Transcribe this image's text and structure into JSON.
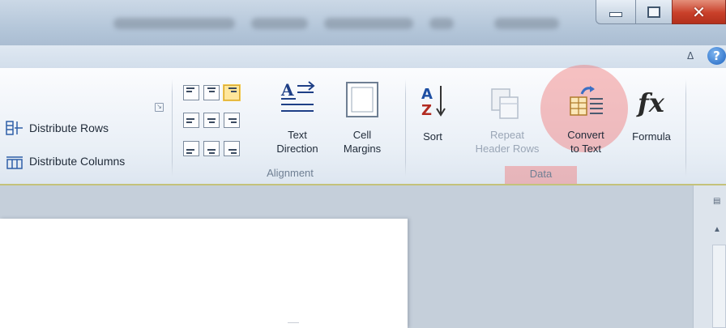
{
  "window": {
    "minimize_glyph": "",
    "maximize_glyph": "",
    "close_glyph": "✕",
    "help_glyph": "?",
    "collapse_glyph": "ᐃ"
  },
  "ribbon": {
    "cell_size": {
      "distribute_rows": "Distribute Rows",
      "distribute_columns": "Distribute Columns"
    },
    "alignment": {
      "group_label": "Alignment",
      "text_direction": [
        "Text",
        "Direction"
      ],
      "cell_margins": [
        "Cell",
        "Margins"
      ]
    },
    "data": {
      "group_label": "Data",
      "sort": "Sort",
      "repeat_header_rows": [
        "Repeat",
        "Header Rows"
      ],
      "convert_to_text": [
        "Convert",
        "to Text"
      ],
      "formula": "Formula"
    }
  },
  "colors": {
    "highlight": "#f07878",
    "selected_alignment": "#ffe69b"
  },
  "icons": [
    "distribute-rows-icon",
    "distribute-columns-icon",
    "text-direction-icon",
    "cell-margins-icon",
    "sort-icon",
    "repeat-header-rows-icon",
    "convert-to-text-icon",
    "formula-icon",
    "help-icon"
  ]
}
